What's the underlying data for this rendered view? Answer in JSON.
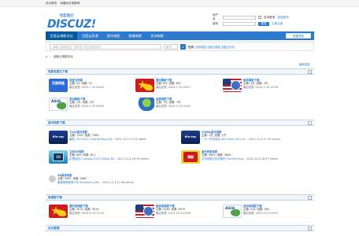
{
  "topbar": {
    "set_home": "设为首页",
    "bookmark": "收藏远去电影网"
  },
  "logo": {
    "bubble": "社区动力",
    "word": "DISCUZ!"
  },
  "login": {
    "account_label": "用户名",
    "password_label": "密码",
    "auto_login": "自动登录",
    "forgot": "找回密码",
    "login_button": "登录",
    "register": "立即注册"
  },
  "nav": {
    "items": [
      "百度云电影论坛",
      "百度云资源",
      "国内电影",
      "欧美电影",
      "亚洲电影"
    ],
    "quick": "快捷导航"
  },
  "search": {
    "placeholder": "请输入搜索内容，请勿出于任何违规目的",
    "select": "帖子",
    "hot_label": "热搜:",
    "hot_items": [
      "活动电影",
      "百度云电影",
      "百度云论坛"
    ]
  },
  "breadcrumb": {
    "forum": "百度云电影论坛"
  },
  "latest": "最新回复",
  "sections": [
    {
      "title": "电影百度云下载",
      "forums": [
        {
          "name": "百度云资源",
          "stats": "主题: 23, 帖数: 23",
          "last": "最后发表: 2025-7-12 08:42"
        },
        {
          "name": "国内最新下载",
          "stats": "主题: 8万, 帖数: 8万",
          "last": "最后发表: 2024-7-15 06:57"
        },
        {
          "name": "欧美最新下载",
          "stats": "主题: 4万, 帖数: 4万",
          "last": "最后发表: 2024-7-15 05:59"
        },
        {
          "name": "亚洲最新下载",
          "stats": "主题: 2万, 帖数: 2万",
          "last": "最后发表: 2024-7-15 06:55"
        },
        {
          "name": "经典电影下载",
          "stats": "主题: 7万, 帖数: 7万",
          "last": "最后发表: 2025-7-12 00:32"
        }
      ]
    },
    {
      "title": "蓝光电影下载",
      "forums": [
        {
          "name": "720p蓝光电影",
          "stats": "主题: 7332, 帖数: 7362",
          "last_link": "最新: 3rd.2021.720p.BluRay.x26...",
          "last_time": "2021-12-4 17:33 admin"
        },
        {
          "name": "1080p蓝光电影",
          "stats": "主题: 1万, 帖数: 1万",
          "last_link": "一小一步玩转会 Dim.Shot.2021.10...",
          "last_time": "2021-12-4 17:22 admin"
        },
        {
          "name": "立体3D电影",
          "stats": "主题: 609, 帖数: 611",
          "last_link": "幻想仙境3 Ozasvb.2019.1080p.3D...",
          "last_time": "2021-12-4 16:16 admin"
        },
        {
          "name": "蓝光原盘电影",
          "stats": "主题: 3641, 帖数: 3642",
          "last_link": "过年回家过年好媳妇 The Running...",
          "last_time": "2021-12-4 18:37 admin"
        },
        {
          "name": "4K高清电影",
          "stats": "主题: 2987, 帖数: 2987",
          "last_link": "最爱爸爸爸爸少年 Roubrrom.208...",
          "last_time": "2021-12-4 17:48 admin"
        }
      ]
    },
    {
      "title": "电视剧下载",
      "forums": [
        {
          "name": "国内电视剧下载",
          "stats": "主题: 3014, 帖数: 3014",
          "last": "最后发表: 2019-9-19 15:41"
        },
        {
          "name": "欧美电视剧下载",
          "stats": "主题: 2248, 帖数: 6375",
          "last": "最后发表: 2021-12-4 09:00"
        },
        {
          "name": "亚洲电视剧下载",
          "stats": "主题: 314, 帖数: 581",
          "last": "最后发表: 2021-12-3 09:01"
        }
      ]
    },
    {
      "title": "论坛管理"
    }
  ],
  "icon_text": {
    "baidu": "百度网盘",
    "bluray": "Blu-ray",
    "asia": "ASIA",
    "hk": "港剧"
  }
}
